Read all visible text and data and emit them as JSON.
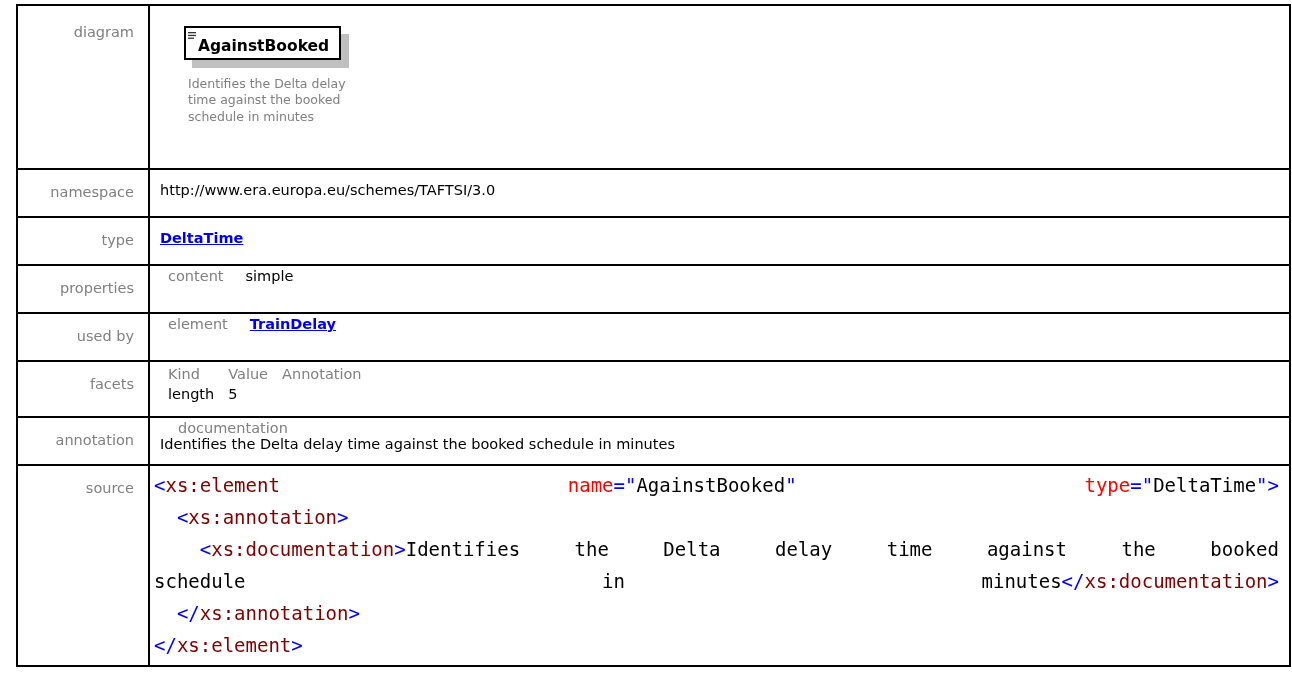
{
  "diagram": {
    "label": "diagram",
    "element_name": "AgainstBooked",
    "description": "Identifies the Delta delay time against the booked schedule in minutes"
  },
  "namespace": {
    "label": "namespace",
    "value": "http://www.era.europa.eu/schemes/TAFTSI/3.0"
  },
  "type": {
    "label": "type",
    "link": "DeltaTime"
  },
  "properties": {
    "label": "properties",
    "items": [
      {
        "key": "content",
        "value": "simple"
      }
    ]
  },
  "used_by": {
    "label": "used by",
    "items": [
      {
        "key": "element",
        "link": "TrainDelay"
      }
    ]
  },
  "facets": {
    "label": "facets",
    "columns": [
      "Kind",
      "Value",
      "Annotation"
    ],
    "rows": [
      [
        "length",
        "5"
      ]
    ]
  },
  "annotation": {
    "label": "annotation",
    "key": "documentation",
    "text": "Identifies the Delta delay time against the booked schedule in minutes"
  },
  "source": {
    "label": "source",
    "lines": [
      {
        "justify": true,
        "words": [
          [
            {
              "kind": "bracket",
              "text": "<"
            },
            {
              "kind": "tag",
              "text": "xs:element"
            }
          ],
          [
            {
              "kind": "attr",
              "text": "name"
            },
            {
              "kind": "bracket",
              "text": "=\""
            },
            {
              "kind": "text",
              "text": "AgainstBooked"
            },
            {
              "kind": "bracket",
              "text": "\""
            }
          ],
          [
            {
              "kind": "attr",
              "text": "type"
            },
            {
              "kind": "bracket",
              "text": "=\""
            },
            {
              "kind": "text",
              "text": "DeltaTime"
            },
            {
              "kind": "bracket",
              "text": "\">"
            }
          ]
        ]
      },
      {
        "kind": "child",
        "words": [
          [
            {
              "kind": "bracket",
              "text": "<"
            },
            {
              "kind": "tag",
              "text": "xs:annotation"
            },
            {
              "kind": "bracket",
              "text": ">"
            }
          ]
        ]
      },
      {
        "justify": true,
        "kind": "grandchild",
        "words": [
          [
            {
              "kind": "bracket",
              "text": "<"
            },
            {
              "kind": "tag",
              "text": "xs:documentation"
            },
            {
              "kind": "bracket",
              "text": ">"
            },
            {
              "kind": "text",
              "text": "Identifies"
            }
          ],
          [
            {
              "kind": "text",
              "text": "the"
            }
          ],
          [
            {
              "kind": "text",
              "text": "Delta"
            }
          ],
          [
            {
              "kind": "text",
              "text": "delay"
            }
          ],
          [
            {
              "kind": "text",
              "text": "time"
            }
          ],
          [
            {
              "kind": "text",
              "text": "against"
            }
          ],
          [
            {
              "kind": "text",
              "text": "the"
            }
          ],
          [
            {
              "kind": "text",
              "text": "booked"
            }
          ]
        ]
      },
      {
        "justify": true,
        "words": [
          [
            {
              "kind": "text",
              "text": "schedule"
            }
          ],
          [
            {
              "kind": "text",
              "text": "in"
            }
          ],
          [
            {
              "kind": "text",
              "text": "minutes"
            },
            {
              "kind": "bracket",
              "text": "</"
            },
            {
              "kind": "tag",
              "text": "xs:documentation"
            },
            {
              "kind": "bracket",
              "text": ">"
            }
          ]
        ]
      },
      {
        "kind": "child",
        "words": [
          [
            {
              "kind": "bracket",
              "text": "</"
            },
            {
              "kind": "tag",
              "text": "xs:annotation"
            },
            {
              "kind": "bracket",
              "text": ">"
            }
          ]
        ]
      },
      {
        "kind": "root",
        "words": [
          [
            {
              "kind": "bracket",
              "text": "</"
            },
            {
              "kind": "tag",
              "text": "xs:element"
            },
            {
              "kind": "bracket",
              "text": ">"
            }
          ]
        ]
      }
    ]
  }
}
